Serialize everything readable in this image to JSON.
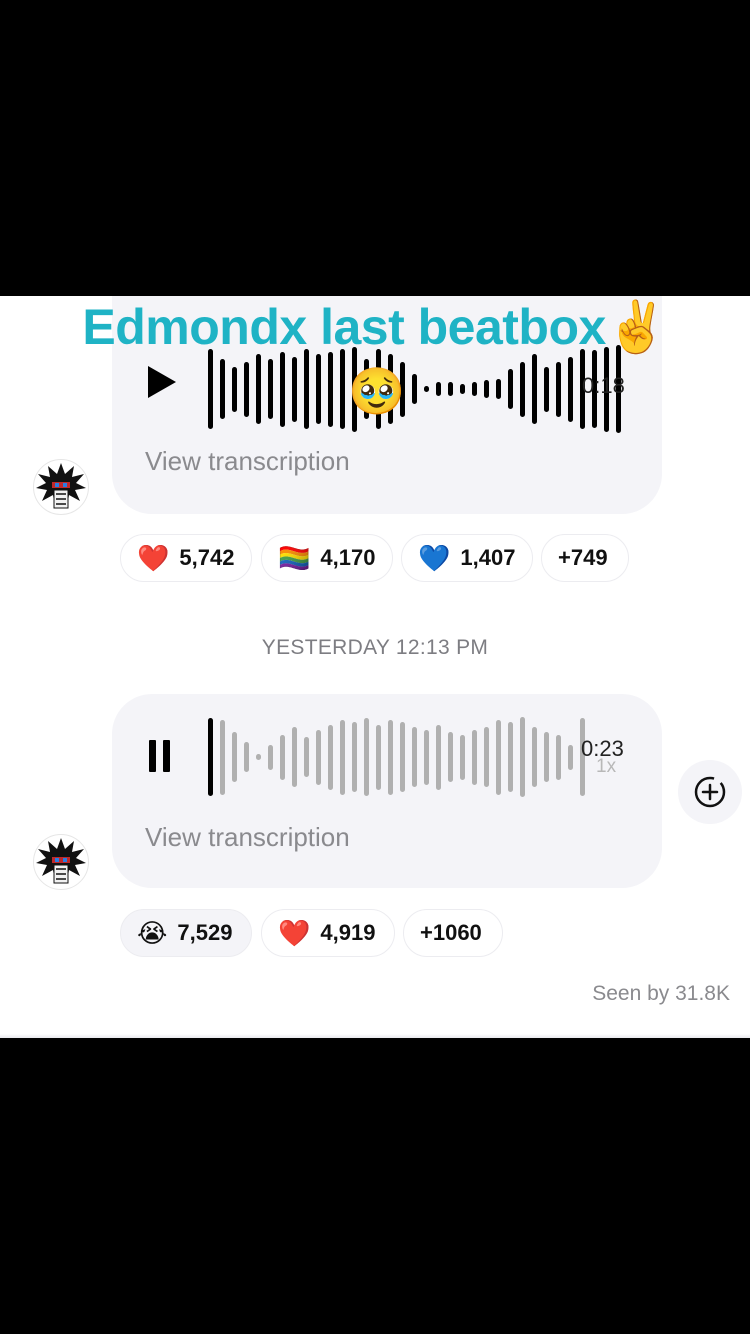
{
  "overlay": {
    "caption": "Edmondx last beatbox",
    "caption_emoji": "✌️",
    "center_emoji": "🥹"
  },
  "messages": [
    {
      "state": "paused",
      "control_icon": "play-icon",
      "duration": "0:18",
      "transcription_label": "View transcription",
      "reactions": [
        {
          "emoji": "❤️",
          "count": "5,742"
        },
        {
          "emoji": "🏳️‍🌈",
          "count": "4,170"
        },
        {
          "emoji": "💙",
          "count": "1,407"
        },
        {
          "more": "+749"
        }
      ]
    },
    {
      "state": "playing",
      "control_icon": "pause-icon",
      "duration": "0:23",
      "speed": "1x",
      "transcription_label": "View transcription",
      "reactions": [
        {
          "emoji": "😭",
          "count": "7,529"
        },
        {
          "emoji": "❤️",
          "count": "4,919"
        },
        {
          "more": "+1060"
        }
      ]
    }
  ],
  "timestamp": "YESTERDAY 12:13 PM",
  "seen_by": "Seen by 31.8K",
  "colors": {
    "caption": "#1fb3c5",
    "bubble": "#f4f4f8",
    "wave_played": "#000000",
    "wave_unplayed": "#b0b0b0"
  }
}
